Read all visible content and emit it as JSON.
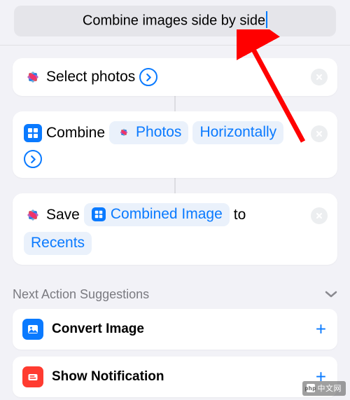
{
  "title": "Combine images side by side",
  "actions": {
    "select": {
      "label": "Select photos"
    },
    "combine": {
      "verb": "Combine",
      "input_chip": "Photos",
      "mode_chip": "Horizontally"
    },
    "save": {
      "verb": "Save",
      "input_chip": "Combined Image",
      "to_word": "to",
      "album_chip": "Recents"
    }
  },
  "suggestions": {
    "header": "Next Action Suggestions",
    "items": [
      {
        "label": "Convert Image"
      },
      {
        "label": "Show Notification"
      }
    ]
  },
  "watermark": "中文网"
}
